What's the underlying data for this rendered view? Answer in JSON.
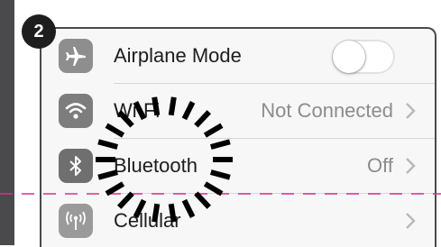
{
  "step_badge": "2",
  "settings": {
    "rows": [
      {
        "id": "airplane",
        "label": "Airplane Mode",
        "value": "",
        "control": "toggle",
        "toggle_state": "off",
        "icon": "airplane-icon",
        "icon_color": "#8e8e8e"
      },
      {
        "id": "wifi",
        "label": "Wi-Fi",
        "value": "Not Connected",
        "control": "chevron",
        "icon": "wifi-icon",
        "icon_color": "#7d7d7d"
      },
      {
        "id": "bluetooth",
        "label": "Bluetooth",
        "value": "Off",
        "control": "chevron",
        "icon": "bluetooth-icon",
        "icon_color": "#6f6f6f"
      },
      {
        "id": "cellular",
        "label": "Cellular",
        "value": "",
        "control": "chevron",
        "icon": "cellular-antenna-icon",
        "icon_color": "#9a9a9a"
      }
    ]
  },
  "colors": {
    "guide_line": "#d63384",
    "burst": "#000000"
  }
}
